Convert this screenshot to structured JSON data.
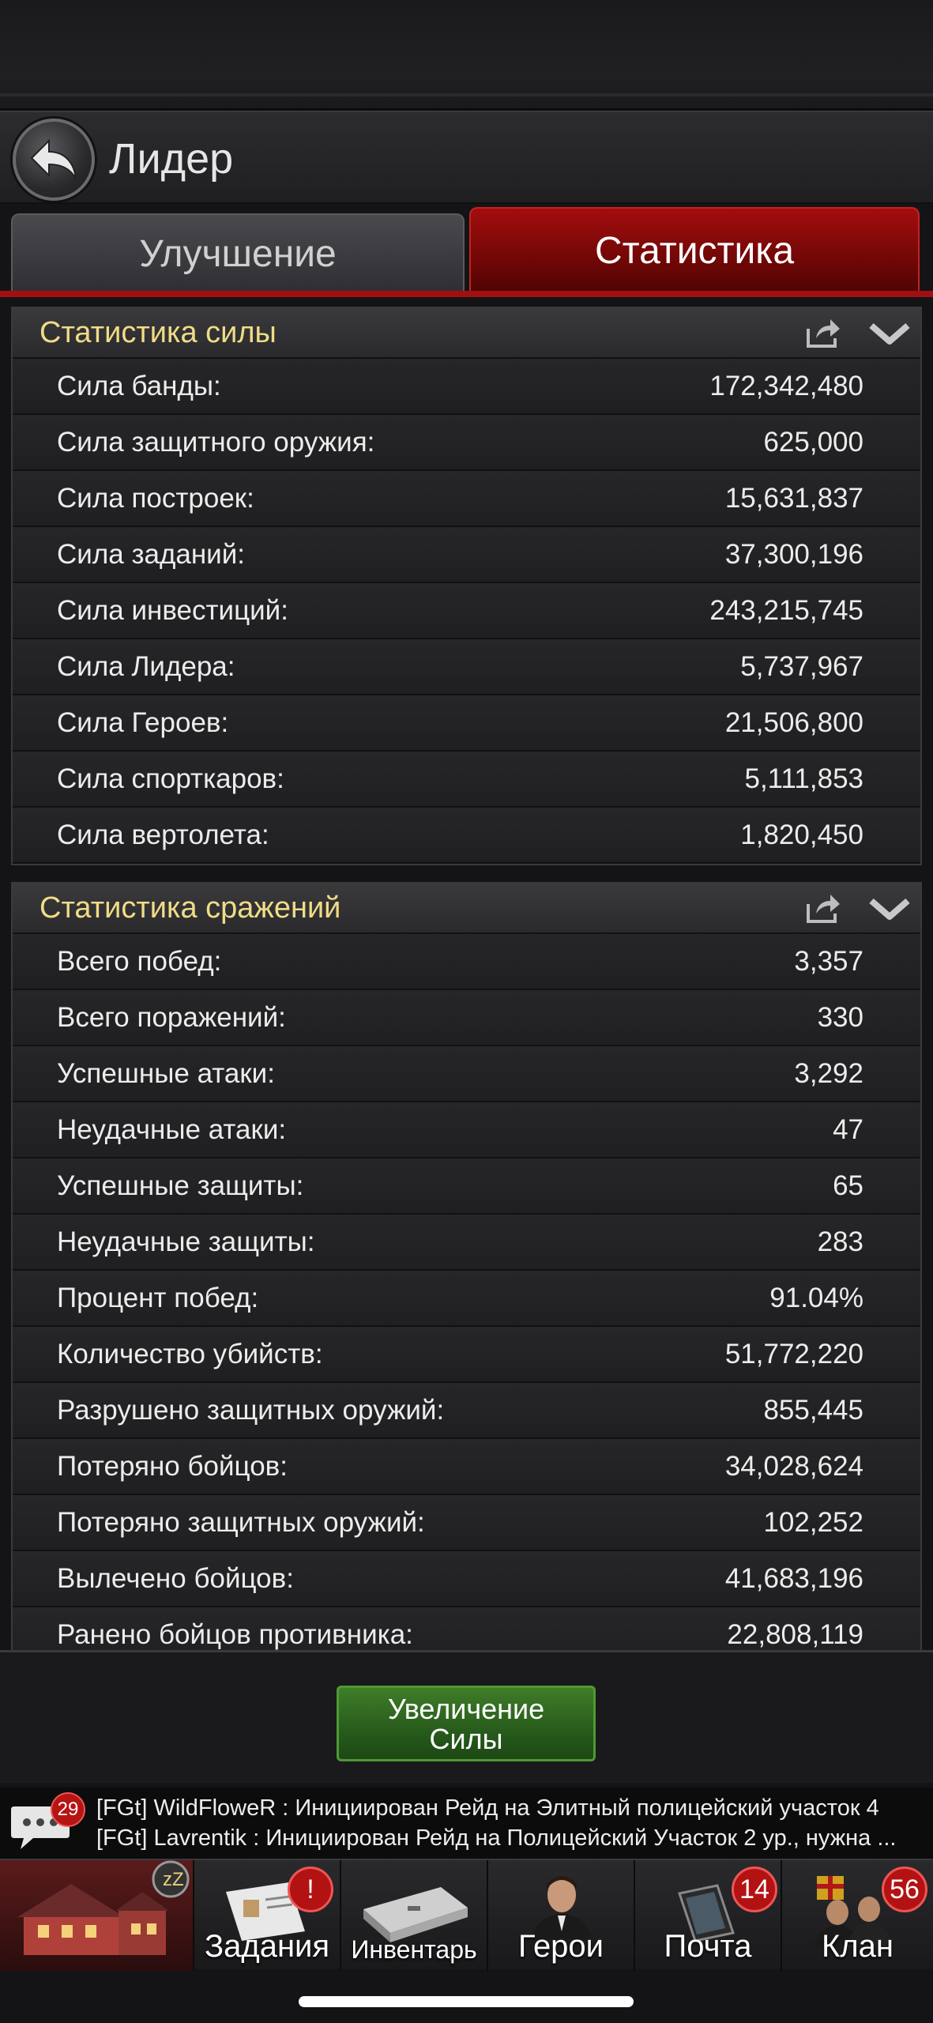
{
  "header": {
    "title": "Лидер"
  },
  "tabs": [
    {
      "label": "Улучшение",
      "active": false
    },
    {
      "label": "Статистика",
      "active": true
    }
  ],
  "power_stats": {
    "title": "Статистика силы",
    "rows": [
      {
        "label": "Сила банды:",
        "value": "172,342,480"
      },
      {
        "label": "Сила защитного оружия:",
        "value": "625,000"
      },
      {
        "label": "Сила построек:",
        "value": "15,631,837"
      },
      {
        "label": "Сила заданий:",
        "value": "37,300,196"
      },
      {
        "label": "Сила инвестиций:",
        "value": "243,215,745"
      },
      {
        "label": "Сила Лидера:",
        "value": "5,737,967"
      },
      {
        "label": "Сила Героев:",
        "value": "21,506,800"
      },
      {
        "label": "Сила спорткаров:",
        "value": "5,111,853"
      },
      {
        "label": "Сила вертолета:",
        "value": "1,820,450"
      }
    ]
  },
  "battle_stats": {
    "title": "Статистика сражений",
    "rows": [
      {
        "label": "Всего побед:",
        "value": "3,357"
      },
      {
        "label": "Всего поражений:",
        "value": "330"
      },
      {
        "label": "Успешные атаки:",
        "value": "3,292"
      },
      {
        "label": "Неудачные атаки:",
        "value": "47"
      },
      {
        "label": "Успешные защиты:",
        "value": "65"
      },
      {
        "label": "Неудачные защиты:",
        "value": "283"
      },
      {
        "label": "Процент побед:",
        "value": "91.04%"
      },
      {
        "label": "Количество убийств:",
        "value": "51,772,220"
      },
      {
        "label": "Разрушено защитных оружий:",
        "value": "855,445"
      },
      {
        "label": "Потеряно бойцов:",
        "value": "34,028,624"
      },
      {
        "label": "Потеряно защитных оружий:",
        "value": "102,252"
      },
      {
        "label": "Вылечено бойцов:",
        "value": "41,683,196"
      },
      {
        "label": "Ранено бойцов противника:",
        "value": "22,808,119"
      }
    ]
  },
  "action": {
    "button_label_line1": "Увеличение",
    "button_label_line2": "Силы"
  },
  "chat": {
    "badge": "29",
    "lines": [
      "[FGt] WildFloweR : Инициирован Рейд на Элитный полицейский участок  4",
      "[FGt] Lavrentik : Инициирован Рейд на Полицейский Участок 2 ур., нужна ..."
    ]
  },
  "nav": {
    "items": [
      {
        "key": "home",
        "label": "",
        "badge": "",
        "icon": "mansion-icon"
      },
      {
        "key": "tasks",
        "label": "Задания",
        "badge": "!",
        "icon": "clipboard-icon"
      },
      {
        "key": "inventory",
        "label": "Инвентарь",
        "badge": "",
        "icon": "briefcase-icon"
      },
      {
        "key": "heroes",
        "label": "Герои",
        "badge": "",
        "icon": "hero-icon"
      },
      {
        "key": "mail",
        "label": "Почта",
        "badge": "14",
        "icon": "phone-icon"
      },
      {
        "key": "clan",
        "label": "Клан",
        "badge": "56",
        "icon": "clan-icon"
      }
    ]
  },
  "colors": {
    "accent_red": "#a30d0d",
    "section_title": "#f0dc86",
    "button_green": "#3f7d28"
  }
}
